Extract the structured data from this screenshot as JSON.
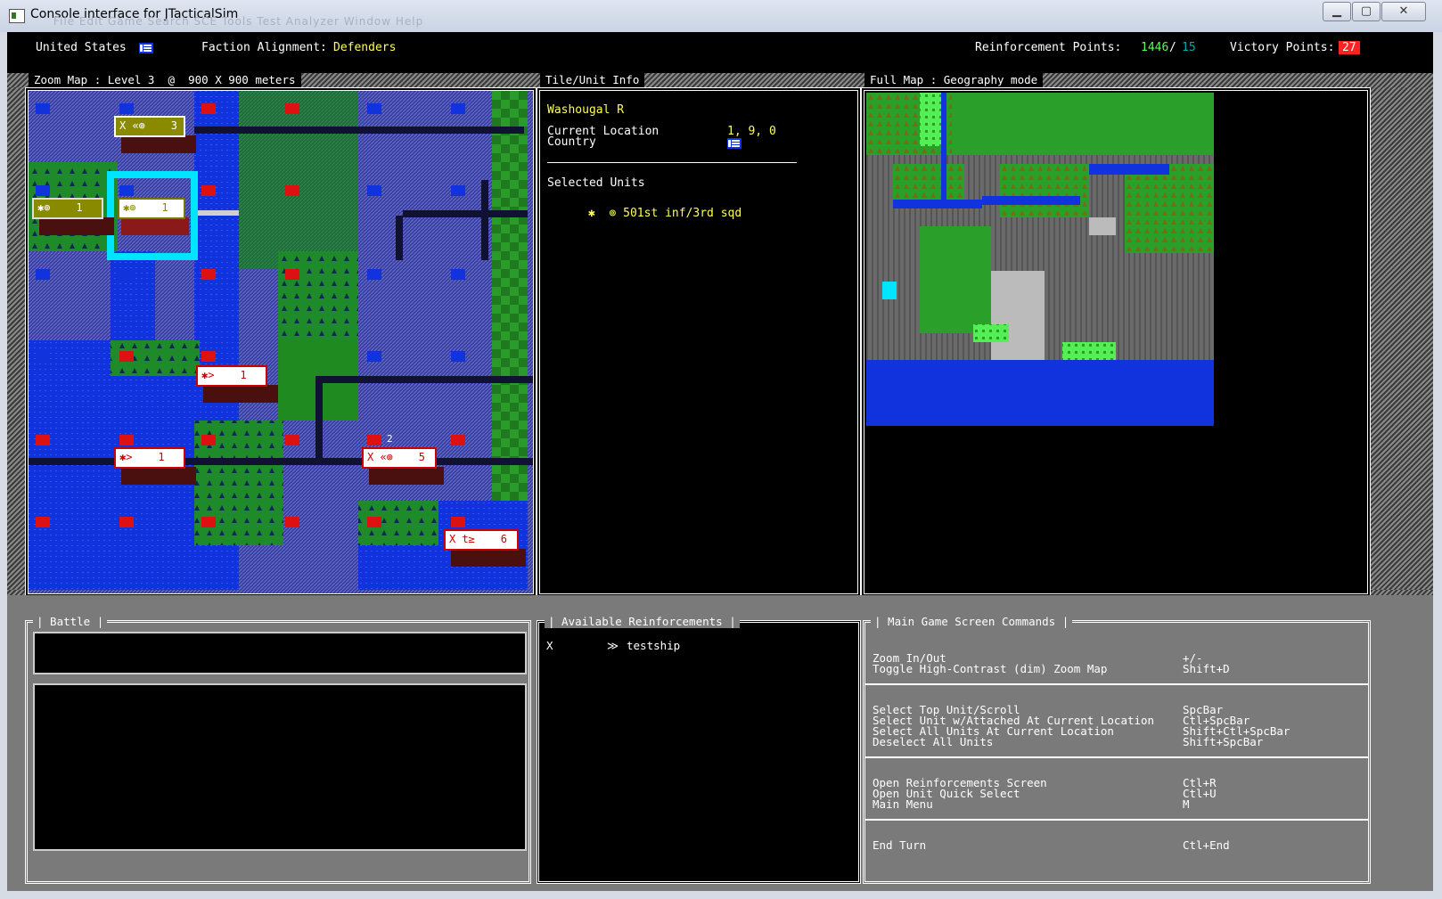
{
  "window": {
    "title": "Console interface for JTacticalSim",
    "menu_ghost": "File   Edit   Game   Search   SCE   Tools   Test   Analyzer   Window   Help"
  },
  "status": {
    "country": "United States",
    "faction_label": "Faction Alignment:",
    "faction": "Defenders",
    "reinf_label": "Reinforcement Points:",
    "reinf_current": "1446",
    "reinf_sep": "/",
    "reinf_per_turn": "15",
    "victory_label": "Victory Points:",
    "victory": "27"
  },
  "panels": {
    "zoom_title": "Zoom Map : Level 3  @  900 X 900 meters",
    "info_title": "Tile/Unit Info",
    "full_title": "Full Map : Geography mode"
  },
  "tile_info": {
    "name": "Washougal R",
    "loc_label": "Current Location",
    "loc_value": "1, 9, 0",
    "country_label": "Country",
    "selected_label": "Selected Units",
    "unit": "✱  ⊚ 501st inf/3rd sqd"
  },
  "map_units": [
    {
      "text": "X «⊚    3"
    },
    {
      "text": "✱⊚    1"
    },
    {
      "text": "✱⊚    1"
    },
    {
      "text": "✱>    1"
    },
    {
      "text": "✱>    1"
    },
    {
      "text": "X «⊚    5"
    },
    {
      "text": "X t≥    6"
    },
    {
      "text": "2"
    }
  ],
  "battle": {
    "title": "| Battle |"
  },
  "reinforcements": {
    "title": "| Available Reinforcements |",
    "items": [
      {
        "mark": "X",
        "icon": "≫",
        "name": "testship"
      }
    ]
  },
  "commands": {
    "title": "| Main Game Screen Commands |",
    "groups": [
      [
        [
          "Zoom In/Out",
          "+/-"
        ],
        [
          "Toggle High-Contrast (dim) Zoom Map",
          "Shift+D"
        ]
      ],
      [
        [
          "Select Top Unit/Scroll",
          "SpcBar"
        ],
        [
          "Select Unit w/Attached At Current Location",
          "Ctl+SpcBar"
        ],
        [
          "Select All Units At Current Location",
          "Shift+Ctl+SpcBar"
        ],
        [
          "Deselect All Units",
          "Shift+SpcBar"
        ]
      ],
      [
        [
          "Open Reinforcements Screen",
          "Ctl+R"
        ],
        [
          "Open Unit Quick Select",
          "Ctl+U"
        ],
        [
          "Main Menu",
          "M"
        ]
      ],
      [
        [
          "End Turn",
          "Ctl+End"
        ]
      ]
    ]
  },
  "colors": {
    "defender_yellow": "#ffff55",
    "reinf_green": "#55ff55",
    "victory_red": "#ff2222",
    "water_blue": "#1133dd",
    "forest_green": "#1f7a1f"
  }
}
